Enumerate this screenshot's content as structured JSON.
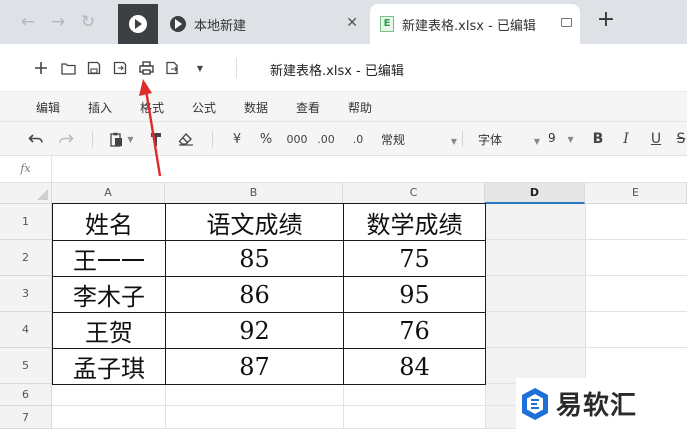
{
  "browser": {
    "tabs": [
      {
        "label": "本地新建"
      },
      {
        "label": "新建表格.xlsx - 已编辑"
      }
    ],
    "tab_file_badge": "E"
  },
  "app": {
    "title": "新建表格.xlsx - 已编辑",
    "toolbar_icons": [
      "add-icon",
      "folder-open-icon",
      "save-icon",
      "save-as-icon",
      "print-icon",
      "export-icon",
      "more-dropdown-icon"
    ]
  },
  "menu": {
    "items": [
      "编辑",
      "插入",
      "格式",
      "公式",
      "数据",
      "查看",
      "帮助"
    ]
  },
  "format_toolbar": {
    "currency": "¥",
    "percent": "%",
    "thousands": "000",
    "inc_decimal": ".00",
    "dec_decimal": ".0",
    "number_format": "常规",
    "font_label": "字体",
    "font_size": "9",
    "bold": "B",
    "italic": "I",
    "underline": "U",
    "strike": "S"
  },
  "formula_bar": {
    "fx_label": "fx",
    "value": ""
  },
  "sheet": {
    "columns": [
      "A",
      "B",
      "C",
      "D",
      "E"
    ],
    "rows": [
      "1",
      "2",
      "3",
      "4",
      "5",
      "6",
      "7"
    ],
    "selected_column": "D",
    "cells": [
      [
        "姓名",
        "语文成绩",
        "数学成绩"
      ],
      [
        "王一一",
        "85",
        "75"
      ],
      [
        "李木子",
        "86",
        "95"
      ],
      [
        "王贺",
        "92",
        "76"
      ],
      [
        "孟子琪",
        "87",
        "84"
      ]
    ]
  },
  "watermark": {
    "text": "易软汇"
  },
  "colors": {
    "arrow": "#e02b2b",
    "selection": "#2b79c2",
    "brand_blue": "#1e6fd9"
  }
}
